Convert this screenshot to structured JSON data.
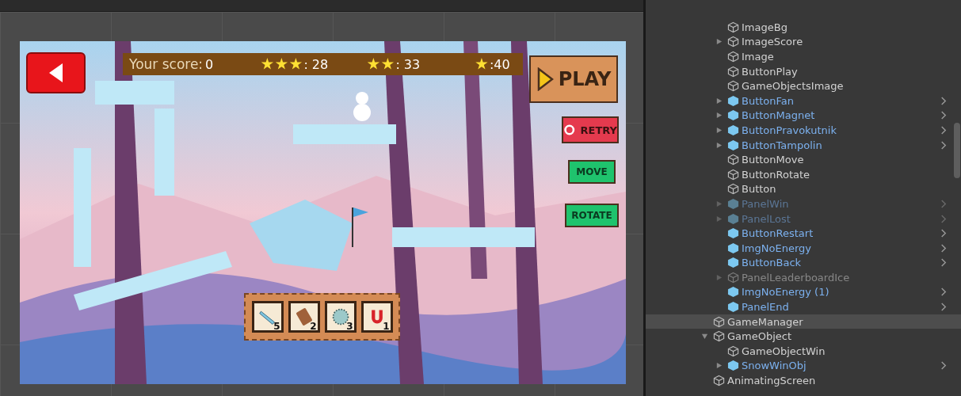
{
  "game": {
    "score_label": "Your score:",
    "score": "0",
    "star_goals": [
      {
        "kind": "three_star",
        "value": ": 28"
      },
      {
        "kind": "two_star",
        "value": ": 33"
      },
      {
        "kind": "one_star",
        "value": ":40"
      }
    ],
    "buttons": [
      {
        "kind": "back"
      },
      {
        "kind": "play",
        "label": "PLAY"
      },
      {
        "kind": "retry",
        "label": "RETRY"
      },
      {
        "kind": "move",
        "label": "MOVE"
      },
      {
        "kind": "rotate",
        "label": "ROTATE"
      }
    ],
    "tools": [
      {
        "kind": "fan",
        "count": "5"
      },
      {
        "kind": "plank",
        "count": "2"
      },
      {
        "kind": "trampoline",
        "count": "3"
      },
      {
        "kind": "magnet",
        "count": "1"
      }
    ]
  },
  "hierarchy": {
    "nested_items": [
      {
        "name": "ImageBg",
        "prefab": false,
        "inactive": false,
        "selected": false
      },
      {
        "name": "ImageScore",
        "prefab": false,
        "inactive": false,
        "expanded": false,
        "selected": false
      },
      {
        "name": "Image",
        "prefab": false,
        "inactive": false,
        "selected": false
      },
      {
        "name": "ButtonPlay",
        "prefab": false,
        "inactive": false,
        "selected": false
      },
      {
        "name": "GameObjectsImage",
        "prefab": false,
        "inactive": false,
        "selected": false
      },
      {
        "name": "ButtonFan",
        "prefab": true,
        "inactive": false,
        "expanded": false,
        "selected": false
      },
      {
        "name": "ButtonMagnet",
        "prefab": true,
        "inactive": false,
        "expanded": false,
        "selected": false
      },
      {
        "name": "ButtonPravokutnik",
        "prefab": true,
        "inactive": false,
        "expanded": false,
        "selected": false
      },
      {
        "name": "ButtonTampolin",
        "prefab": true,
        "inactive": false,
        "expanded": false,
        "selected": false
      },
      {
        "name": "ButtonMove",
        "prefab": false,
        "inactive": false,
        "selected": false
      },
      {
        "name": "ButtonRotate",
        "prefab": false,
        "inactive": false,
        "selected": false
      },
      {
        "name": "Button",
        "prefab": false,
        "inactive": false,
        "selected": false
      },
      {
        "name": "PanelWin",
        "prefab": true,
        "inactive": true,
        "expanded": false,
        "selected": false
      },
      {
        "name": "PanelLost",
        "prefab": true,
        "inactive": true,
        "expanded": false,
        "selected": false
      },
      {
        "name": "ButtonRestart",
        "prefab": true,
        "inactive": false,
        "selected": false
      },
      {
        "name": "ImgNoEnergy",
        "prefab": true,
        "inactive": false,
        "selected": false
      },
      {
        "name": "ButtonBack",
        "prefab": true,
        "inactive": false,
        "selected": false
      },
      {
        "name": "PanelLeaderboardIce",
        "prefab": false,
        "inactive": true,
        "expanded": false,
        "selected": false
      },
      {
        "name": "ImgNoEnergy (1)",
        "prefab": true,
        "inactive": false,
        "selected": false
      },
      {
        "name": "PanelEnd",
        "prefab": true,
        "inactive": false,
        "selected": false
      }
    ],
    "items": [
      {
        "name": "GameManager",
        "prefab": false,
        "inactive": false,
        "selected": true
      },
      {
        "name": "GameObject",
        "prefab": false,
        "inactive": false,
        "expanded": true,
        "selected": false,
        "children": [
          {
            "name": "GameObjectWin",
            "prefab": false,
            "inactive": false,
            "selected": false
          },
          {
            "name": "SnowWinObj",
            "prefab": true,
            "inactive": false,
            "expanded": false,
            "selected": false
          }
        ]
      },
      {
        "name": "AnimatingScreen",
        "prefab": false,
        "inactive": false,
        "selected": false
      }
    ]
  }
}
